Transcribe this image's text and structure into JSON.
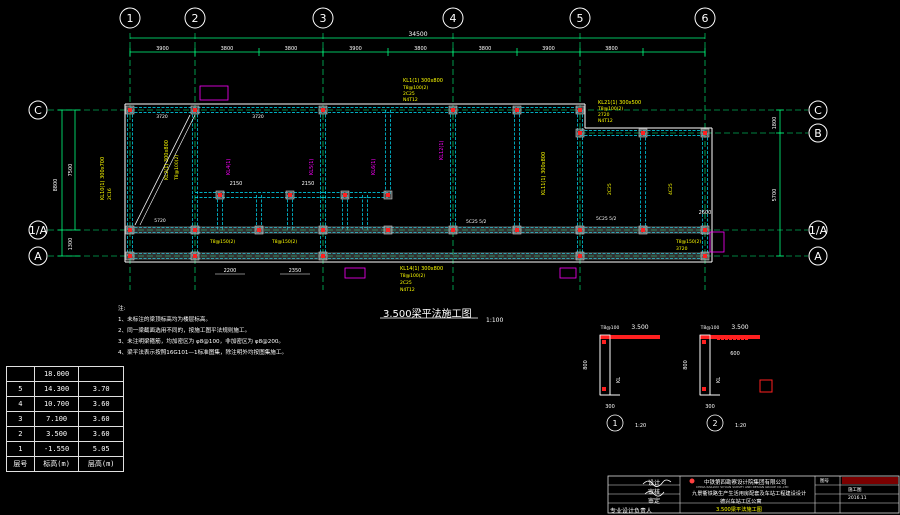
{
  "colors": {
    "background": "#000000",
    "axis": "#00ff7f",
    "wall": "#ffffff",
    "beam": "#00e5ff",
    "column": "#ff2020",
    "label_yellow": "#ffff00",
    "label_magenta": "#ff00ff",
    "grey_hatch": "#8c8c8c",
    "red_text": "#ff4040"
  },
  "grid": {
    "columns": [
      "1",
      "2",
      "3",
      "4",
      "5",
      "6"
    ],
    "rows": [
      "C",
      "B",
      "1/A",
      "A"
    ],
    "total_span": "34500",
    "bay_spans": [
      "3900",
      "3800",
      "3800",
      "3900",
      "3800",
      "3800",
      "3900",
      "3800"
    ],
    "left_dims": [
      "7500",
      "8800",
      "1300"
    ],
    "right_dims": [
      "1800",
      "5700"
    ]
  },
  "plan": {
    "title": "3.500梁平法施工图",
    "scale": "1:100",
    "beam_labels": {
      "kl1": "KL1(1) 300x800",
      "kl2": "KL2(1) 300x800",
      "kl4": "KL4(1)",
      "kl5": "KL5(1)",
      "kl6": "KL6(1)",
      "kl10": "KL10(1) 300x700",
      "kl11": "KL11(1) 300x800",
      "kl12": "KL12(1)",
      "kl14": "KL14(1) 300x800",
      "kl21": "KL21(1) 300x500"
    },
    "rebar_labels": [
      "T8@100(2)",
      "2C25",
      "N4T12",
      "2720",
      "3720",
      "4C25",
      "2C16",
      "T8@150(2)",
      "4T25",
      "5C25 5/2"
    ],
    "dim_labels": [
      "2150",
      "2150",
      "2200",
      "2350",
      "2600",
      "2500",
      "3720",
      "3720",
      "5720"
    ]
  },
  "notes": {
    "heading": "注:",
    "lines": [
      "1、未标注的梁顶标高均为楼层标高。",
      "2、同一梁截面选用不同的，按施工图平法规则施工。",
      "3、未注明梁箍筋，均加密区为 φ8@100，非加密区为 φ8@200。",
      "4、梁平法表示按照16G101—1标准图集，除注明外均按图集施工。"
    ]
  },
  "details": [
    {
      "num": "1",
      "scale": "1:20",
      "dim_top": "3.500",
      "dim_h": "800",
      "dim_w": "300",
      "rebar": "T8@100",
      "kl": "KL"
    },
    {
      "num": "2",
      "scale": "1:20",
      "dim_top": "3.500",
      "dim_h": "800",
      "dim_w": "300",
      "dim_span": "600",
      "rebar": "T8@100",
      "kl": "KL"
    }
  ],
  "floor_table": {
    "rows": [
      [
        "",
        "18.000",
        ""
      ],
      [
        "5",
        "14.300",
        "3.70"
      ],
      [
        "4",
        "10.700",
        "3.60"
      ],
      [
        "3",
        "7.100",
        "3.60"
      ],
      [
        "2",
        "3.500",
        "3.60"
      ],
      [
        "1",
        "-1.550",
        "5.05"
      ]
    ],
    "header": [
      "层号",
      "标高(m)",
      "层高(m)"
    ]
  },
  "title_block": {
    "design_label": "设计",
    "review_label": "审核",
    "approve_label": "审定",
    "leader_label": "专业设计负责人",
    "company": "中铁第四勘察设计院集团有限公司",
    "company_en": "CHINA RAILWAY SIYUAN SURVEY AND DESIGN GROUP CO.,LTD",
    "project": "九景衢铁路生产生活用房配套及车站工程建设设计",
    "sub_project": "德兴车站工区公寓",
    "drawing_name": "3.500梁平法施工图",
    "right_label": "图号",
    "stage": "施工图",
    "date": "2016.11"
  }
}
